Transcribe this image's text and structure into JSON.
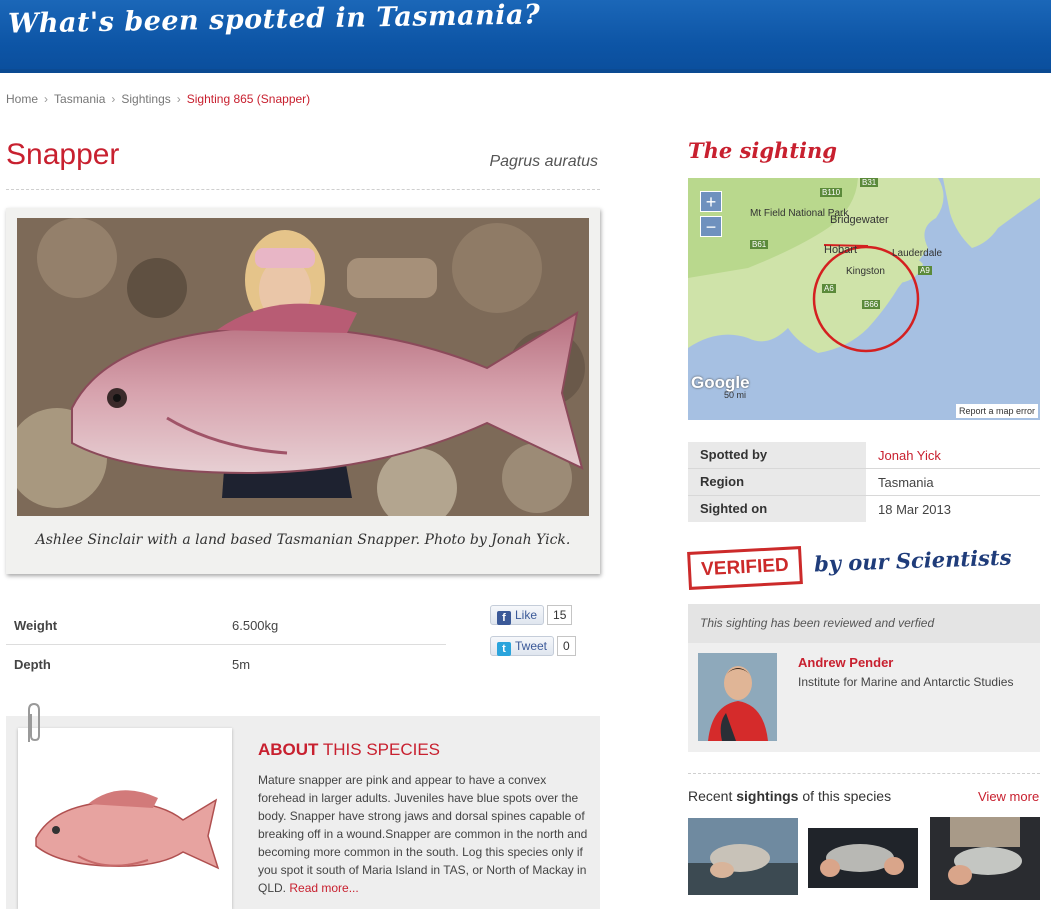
{
  "banner": {
    "title": "What's been spotted in Tasmania?"
  },
  "breadcrumb": {
    "items": [
      "Home",
      "Tasmania",
      "Sightings"
    ],
    "current": "Sighting 865 (Snapper)",
    "separator": "›"
  },
  "species": {
    "common_name": "Snapper",
    "scientific_name": "Pagrus auratus"
  },
  "photo": {
    "caption": "Ashlee Sinclair with a land based Tasmanian Snapper. Photo by Jonah Yick."
  },
  "stats": [
    {
      "label": "Weight",
      "value": "6.500kg"
    },
    {
      "label": "Depth",
      "value": "5m"
    }
  ],
  "social": {
    "like": {
      "label": "Like",
      "count": "15",
      "icon": "facebook-icon"
    },
    "tweet": {
      "label": "Tweet",
      "count": "0",
      "icon": "twitter-icon"
    }
  },
  "about": {
    "heading_bold": "About",
    "heading_rest": " this species",
    "text": "Mature snapper are pink and appear to have a convex forehead in larger adults. Juveniles have blue spots over the body. Snapper have strong jaws and dorsal spines capable of breaking off in a wound.Snapper are common in the north and becoming more common in the south. Log this species only if you spot it south of Maria Island in TAS, or North of Mackay in QLD.",
    "read_more": "Read more..."
  },
  "sighting": {
    "heading": "The sighting",
    "map": {
      "labels": [
        "Mt Field National Park",
        "Bridgewater",
        "Hobart",
        "Lauderdale",
        "Kingston"
      ],
      "roads": [
        "B110",
        "B31",
        "B61",
        "A6",
        "A9",
        "B66"
      ],
      "google": "Google",
      "scale": "50 mi",
      "report": "Report a map error"
    },
    "details": [
      {
        "label": "Spotted by",
        "value": "Jonah Yick",
        "link": true
      },
      {
        "label": "Region",
        "value": "Tasmania",
        "link": false
      },
      {
        "label": "Sighted on",
        "value": "18 Mar 2013",
        "link": false
      }
    ]
  },
  "verified": {
    "stamp": "VERIFIED",
    "tagline": "by our Scientists",
    "note": "This sighting has been reviewed and verfied",
    "scientist_name": "Andrew Pender",
    "scientist_org": "Institute for Marine and Antarctic Studies"
  },
  "recent": {
    "title_pre": "Recent ",
    "title_bold": "sightings",
    "title_post": " of this species",
    "view_more": "View more"
  },
  "colors": {
    "accent_red": "#c8202f",
    "banner_blue": "#0d55a6",
    "navy_text": "#1f3c7a"
  }
}
